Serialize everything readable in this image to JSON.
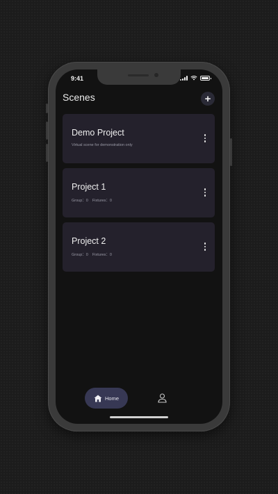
{
  "status_bar": {
    "time": "9:41"
  },
  "header": {
    "title": "Scenes",
    "add_icon": "plus-icon"
  },
  "scenes": [
    {
      "title": "Demo Project",
      "subtitle": "Virtual scene for demonstration only",
      "meta": [],
      "menu_icon": "more-vertical-icon"
    },
    {
      "title": "Project 1",
      "subtitle": "",
      "meta": [
        "Group：0",
        "Fixtures：0"
      ],
      "menu_icon": "more-vertical-icon"
    },
    {
      "title": "Project 2",
      "subtitle": "",
      "meta": [
        "Group：0",
        "Fixtures：0"
      ],
      "menu_icon": "more-vertical-icon"
    }
  ],
  "tab_bar": {
    "home": {
      "label": "Home",
      "icon": "home-icon",
      "active": true
    },
    "profile": {
      "icon": "user-icon"
    }
  },
  "colors": {
    "background": "#1c1c1c",
    "screen": "#121212",
    "card": "#24212c",
    "active_tab": "#373854"
  }
}
